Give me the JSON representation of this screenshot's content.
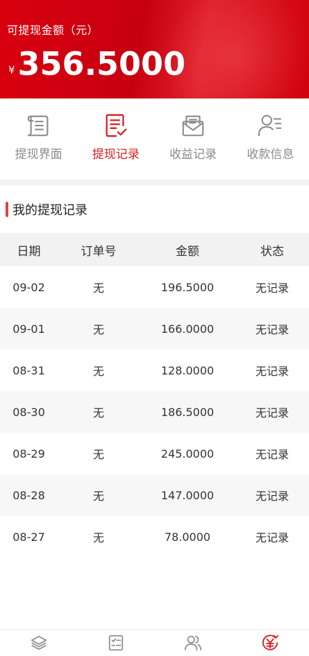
{
  "header": {
    "title": "可提现金额（元）",
    "currency_symbol": "¥",
    "amount": "356.5000"
  },
  "tabs": [
    {
      "label": "提现界面",
      "icon": "scroll-icon",
      "active": false
    },
    {
      "label": "提现记录",
      "icon": "document-check-icon",
      "active": true
    },
    {
      "label": "收益记录",
      "icon": "envelope-icon",
      "active": false
    },
    {
      "label": "收款信息",
      "icon": "user-list-icon",
      "active": false
    }
  ],
  "section": {
    "title": "我的提现记录"
  },
  "table": {
    "headers": [
      "日期",
      "订单号",
      "金额",
      "状态"
    ],
    "rows": [
      [
        "09-02",
        "无",
        "196.5000",
        "无记录"
      ],
      [
        "09-01",
        "无",
        "166.0000",
        "无记录"
      ],
      [
        "08-31",
        "无",
        "128.0000",
        "无记录"
      ],
      [
        "08-30",
        "无",
        "186.5000",
        "无记录"
      ],
      [
        "08-29",
        "无",
        "245.0000",
        "无记录"
      ],
      [
        "08-28",
        "无",
        "147.0000",
        "无记录"
      ],
      [
        "08-27",
        "无",
        "78.0000",
        "无记录"
      ]
    ]
  },
  "bottom_nav": [
    {
      "icon": "layers-icon",
      "active": false
    },
    {
      "icon": "checklist-icon",
      "active": false
    },
    {
      "icon": "users-icon",
      "active": false
    },
    {
      "icon": "yen-circle-icon",
      "active": true
    }
  ],
  "colors": {
    "brand_red": "#d81e1e",
    "inactive_gray": "#8a8a8a"
  }
}
